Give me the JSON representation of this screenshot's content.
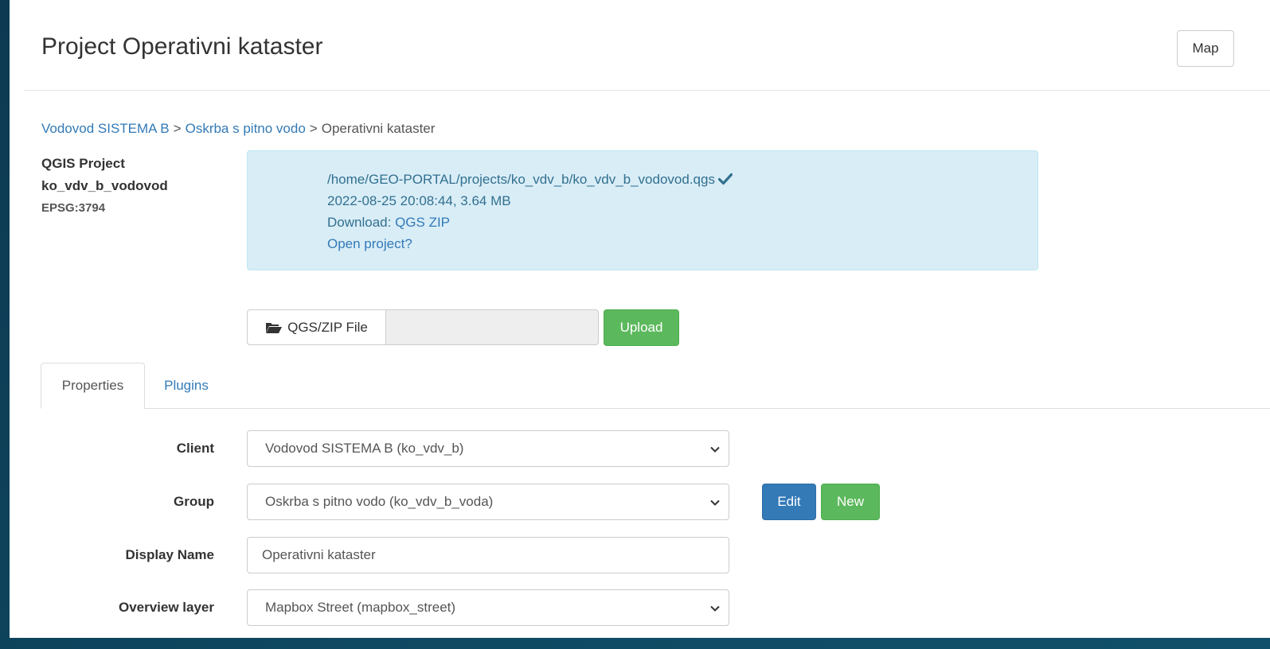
{
  "header": {
    "title": "Project Operativni kataster",
    "map_button": "Map"
  },
  "breadcrumb": {
    "client": "Vodovod SISTEMA B",
    "group": "Oskrba s pitno vodo",
    "current": "Operativni kataster",
    "separator": ">"
  },
  "project_info": {
    "label": "QGIS Project",
    "name": "ko_vdv_b_vodovod",
    "epsg": "EPSG:3794"
  },
  "file_info": {
    "path": "/home/GEO-PORTAL/projects/ko_vdv_b/ko_vdv_b_vodovod.qgs",
    "modified_size": "2022-08-25 20:08:44, 3.64 MB",
    "download_label": "Download:",
    "download_link": "QGS ZIP",
    "open_project": "Open project?",
    "status_icon": "check-icon"
  },
  "upload": {
    "file_button": "QGS/ZIP File",
    "file_icon": "folder-open-icon",
    "file_value": "",
    "upload_button": "Upload"
  },
  "tabs": [
    {
      "label": "Properties",
      "active": true
    },
    {
      "label": "Plugins",
      "active": false
    }
  ],
  "form": {
    "client": {
      "label": "Client",
      "value": "Vodovod SISTEMA B (ko_vdv_b)"
    },
    "group": {
      "label": "Group",
      "value": "Oskrba s pitno vodo (ko_vdv_b_voda)",
      "edit_button": "Edit",
      "new_button": "New"
    },
    "display_name": {
      "label": "Display Name",
      "value": "Operativni kataster"
    },
    "overview_layer": {
      "label": "Overview layer",
      "value": "Mapbox Street (mapbox_street)"
    }
  },
  "colors": {
    "primary": "#337ab7",
    "success": "#5cb85c",
    "info_bg": "#d9edf7",
    "background": "#0f4a63"
  }
}
